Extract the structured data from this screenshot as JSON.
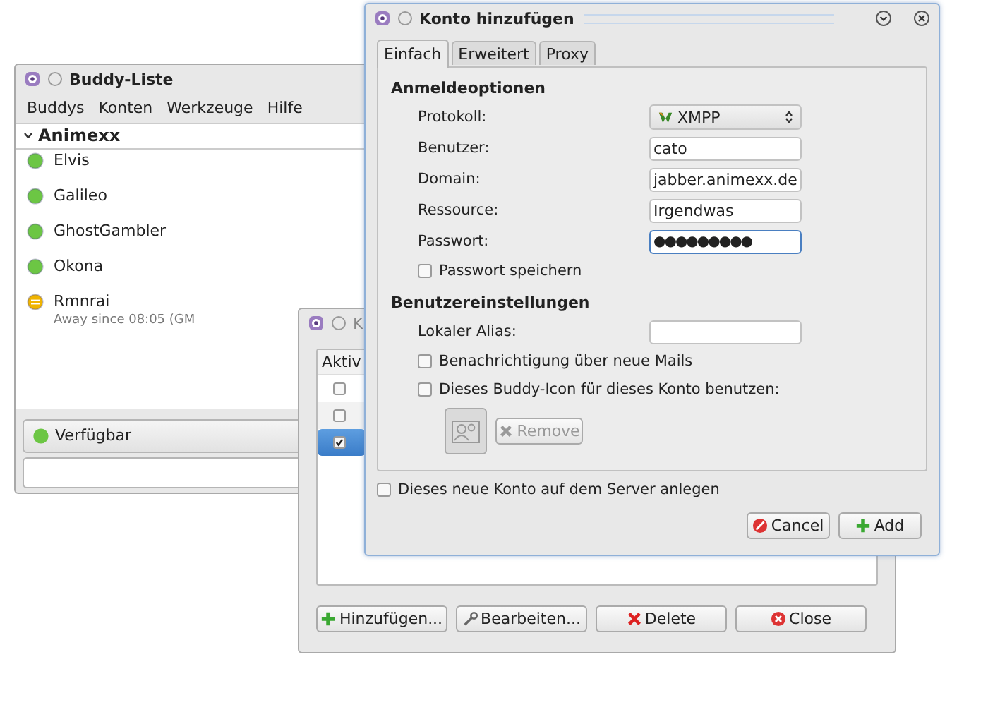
{
  "buddy_list_window": {
    "title": "Buddy-Liste",
    "menu": [
      "Buddys",
      "Konten",
      "Werkzeuge",
      "Hilfe"
    ],
    "group": {
      "name": "Animexx",
      "expanded": true
    },
    "buddies": [
      {
        "name": "Elvis",
        "away": false
      },
      {
        "name": "Galileo",
        "away": false
      },
      {
        "name": "GhostGambler",
        "away": false
      },
      {
        "name": "Okona",
        "away": false
      },
      {
        "name": "Rmnrai",
        "away": true,
        "status_text": "Away since 08:05 (GM"
      }
    ],
    "status_selector": {
      "label": "Verfügbar"
    }
  },
  "accounts_window": {
    "title": "K",
    "columns": [
      "Aktiv"
    ],
    "rows": [
      {
        "active": false,
        "selected": false
      },
      {
        "active": false,
        "selected": false
      },
      {
        "active": true,
        "selected": true
      }
    ],
    "buttons": [
      {
        "label": "Hinzufügen..."
      },
      {
        "label": "Bearbeiten..."
      },
      {
        "label": "Delete"
      },
      {
        "label": "Close"
      }
    ]
  },
  "add_account_window": {
    "title": "Konto hinzufügen",
    "tabs": [
      {
        "label": "Einfach",
        "selected": true
      },
      {
        "label": "Erweitert",
        "selected": false
      },
      {
        "label": "Proxy",
        "selected": false
      }
    ],
    "login_section": {
      "heading": "Anmeldeoptionen",
      "fields": [
        {
          "kind": "select",
          "label": "Protokoll:",
          "value": "XMPP",
          "focused": false
        },
        {
          "kind": "text",
          "label": "Benutzer:",
          "value": "cato",
          "focused": false
        },
        {
          "kind": "text",
          "label": "Domain:",
          "value": "jabber.animexx.de",
          "focused": false
        },
        {
          "kind": "text",
          "label": "Ressource:",
          "value": "Irgendwas",
          "focused": false
        },
        {
          "kind": "password",
          "label": "Passwort:",
          "value": "●●●●●●●●●",
          "focused": true
        }
      ],
      "remember_password": {
        "label": "Passwort speichern",
        "checked": false
      }
    },
    "user_section": {
      "heading": "Benutzereinstellungen",
      "alias": {
        "label": "Lokaler Alias:"
      },
      "options": [
        {
          "label": "Benachrichtigung über neue Mails",
          "checked": false
        },
        {
          "label": "Dieses Buddy-Icon für dieses Konto benutzen:",
          "checked": false
        }
      ],
      "remove_button": {
        "label": "Remove",
        "disabled": true
      }
    },
    "register": {
      "label": "Dieses neue Konto auf dem Server anlegen",
      "checked": false
    },
    "buttons": [
      {
        "label": "Cancel"
      },
      {
        "label": "Add"
      }
    ]
  }
}
